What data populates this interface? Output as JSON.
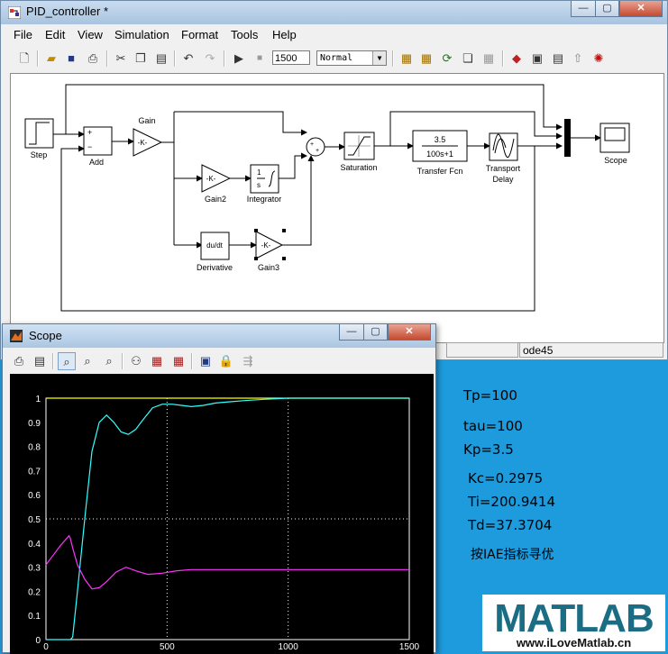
{
  "simulink": {
    "title": "PID_controller *",
    "menu": [
      "File",
      "Edit",
      "View",
      "Simulation",
      "Format",
      "Tools",
      "Help"
    ],
    "stop_time": "1500",
    "sim_mode": "Normal",
    "status_solver": "ode45",
    "blocks": {
      "step": "Step",
      "add": "Add",
      "add_plus": "+",
      "add_minus": "−",
      "gain_top": "Gain",
      "gain_k": "-K-",
      "gain2": "Gain2",
      "gain2_k": "-K-",
      "integrator": "Integrator",
      "integrator_num": "1",
      "integrator_den": "s",
      "derivative": "Derivative",
      "derivative_text": "du/dt",
      "gain3": "Gain3",
      "gain3_k": "-K-",
      "saturation": "Saturation",
      "transfer_fcn": "Transfer Fcn",
      "tf_num": "3.5",
      "tf_den": "100s+1",
      "transport_delay_1": "Transport",
      "transport_delay_2": "Delay",
      "scope": "Scope"
    }
  },
  "scope_window": {
    "title": "Scope",
    "colors": {
      "yellow": "#ffff00",
      "cyan": "#33ffff",
      "magenta": "#ff33ff",
      "grid": "#ffffff"
    }
  },
  "params": {
    "tp": "Tp=100",
    "tau": "tau=100",
    "kp": "Kp=3.5",
    "kc": "Kc=0.2975",
    "ti": "Ti=200.9414",
    "td": "Td=37.3704",
    "method": "按IAE指标寻优"
  },
  "logo": {
    "text": "MATLAB",
    "url": "www.iLoveMatlab.cn"
  },
  "chart_data": {
    "type": "line",
    "xlim": [
      0,
      1500
    ],
    "ylim": [
      0,
      1
    ],
    "xticks": [
      "0",
      "500",
      "1000",
      "1500"
    ],
    "yticks": [
      "0",
      "0.1",
      "0.2",
      "0.3",
      "0.4",
      "0.5",
      "0.6",
      "0.7",
      "0.8",
      "0.9",
      "1"
    ],
    "grid": true,
    "series": [
      {
        "color": "#ffff00",
        "x": [
          0,
          1500
        ],
        "y": [
          1,
          1
        ]
      },
      {
        "color": "#33ffff",
        "x": [
          0,
          100,
          110,
          130,
          160,
          190,
          220,
          250,
          280,
          310,
          340,
          370,
          400,
          440,
          480,
          520,
          560,
          600,
          650,
          700,
          760,
          820,
          900,
          1000,
          1100,
          1200,
          1300,
          1400,
          1500
        ],
        "y": [
          0,
          0,
          0.01,
          0.2,
          0.5,
          0.78,
          0.9,
          0.93,
          0.9,
          0.86,
          0.85,
          0.87,
          0.91,
          0.96,
          0.975,
          0.975,
          0.97,
          0.965,
          0.97,
          0.98,
          0.985,
          0.99,
          0.995,
          1,
          1,
          1,
          1,
          1,
          1
        ]
      },
      {
        "color": "#ff33ff",
        "x": [
          0,
          30,
          60,
          95,
          100,
          110,
          130,
          160,
          190,
          220,
          250,
          290,
          330,
          370,
          420,
          480,
          540,
          600,
          700,
          800,
          1000,
          1200,
          1500
        ],
        "y": [
          0.31,
          0.35,
          0.39,
          0.43,
          0.42,
          0.38,
          0.31,
          0.25,
          0.21,
          0.215,
          0.24,
          0.28,
          0.3,
          0.285,
          0.27,
          0.275,
          0.285,
          0.29,
          0.29,
          0.29,
          0.29,
          0.29,
          0.29
        ]
      }
    ]
  }
}
